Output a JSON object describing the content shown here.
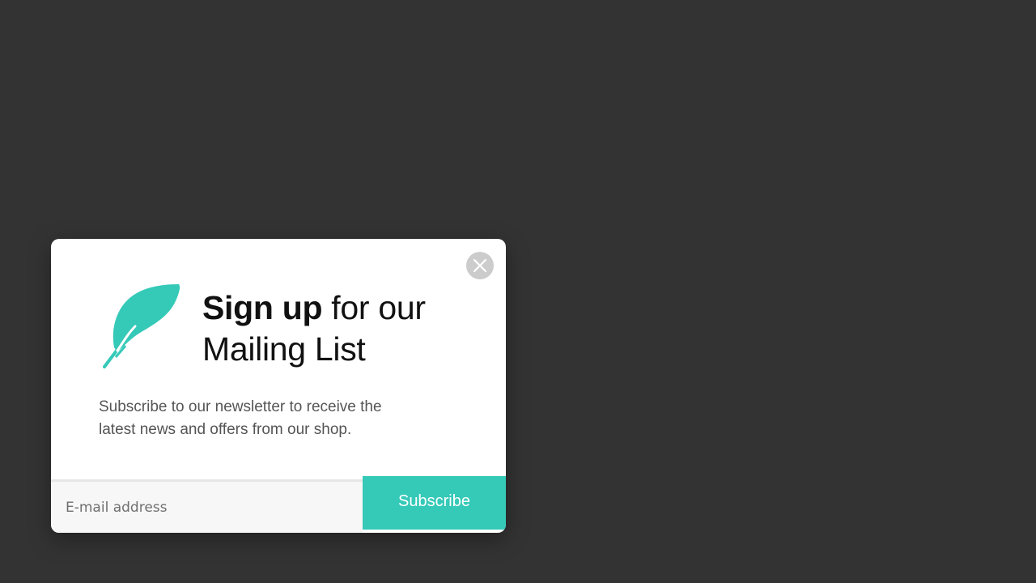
{
  "popup": {
    "heading_bold": "Sign up",
    "heading_rest_line1": " for our",
    "heading_line2": "Mailing List",
    "description": "Subscribe to our newsletter to receive the latest news and offers from our shop.",
    "email_placeholder": "E-mail address",
    "email_value": "",
    "subscribe_label": "Subscribe",
    "icons": {
      "logo": "feather-icon",
      "close": "close-icon"
    }
  },
  "colors": {
    "accent": "#35c9b8",
    "background": "#333333",
    "close_button": "#cccccc"
  }
}
